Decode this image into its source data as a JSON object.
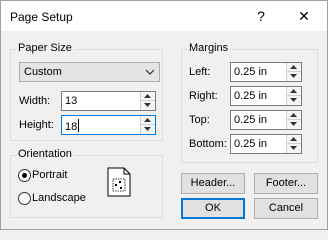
{
  "window": {
    "title": "Page Setup",
    "help_glyph": "?",
    "close_glyph": "✕"
  },
  "paper_size": {
    "label": "Paper Size",
    "selected": "Custom",
    "width_label": "Width:",
    "width_value": "13",
    "height_label": "Height:",
    "height_value": "18"
  },
  "margins": {
    "label": "Margins",
    "left_label": "Left:",
    "left_value": "0.25 in",
    "right_label": "Right:",
    "right_value": "0.25 in",
    "top_label": "Top:",
    "top_value": "0.25 in",
    "bottom_label": "Bottom:",
    "bottom_value": "0.25 in"
  },
  "orientation": {
    "label": "Orientation",
    "portrait_label": "Portrait",
    "landscape_label": "Landscape",
    "selected": "Portrait"
  },
  "buttons": {
    "header": "Header...",
    "footer": "Footer...",
    "ok": "OK",
    "cancel": "Cancel"
  },
  "icons": {
    "spin_up": "chevron-up-icon",
    "spin_down": "chevron-down-icon",
    "dropdown": "chevron-down-icon",
    "page_orientation": "portrait-page-icon"
  },
  "colors": {
    "accent": "#0078d7",
    "background": "#f0f0f0"
  }
}
